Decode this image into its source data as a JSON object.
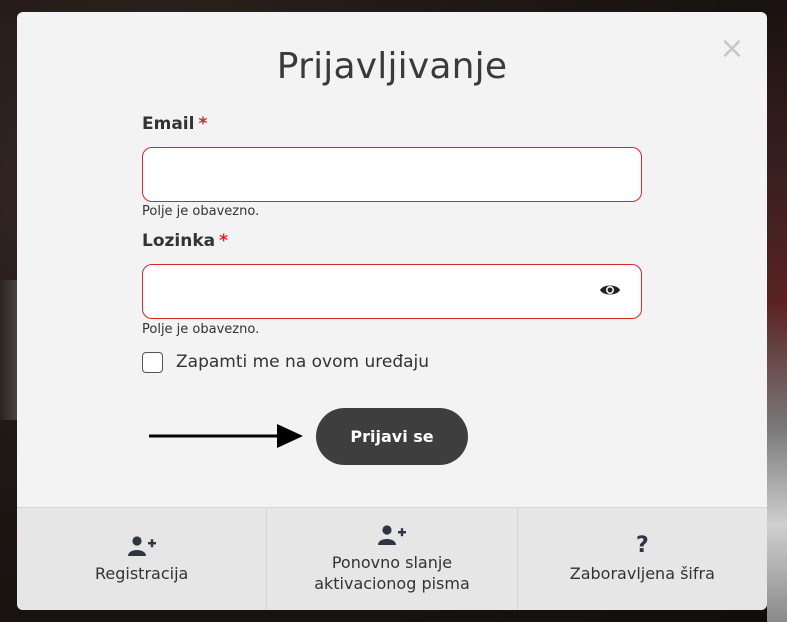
{
  "modal": {
    "title": "Prijavljivanje",
    "close_glyph": "×"
  },
  "form": {
    "email": {
      "label": "Email",
      "required_marker": "*",
      "value": "",
      "error": "Polje je obavezno."
    },
    "password": {
      "label": "Lozinka",
      "required_marker": "*",
      "value": "",
      "error": "Polje je obavezno.",
      "toggle_icon": "eye-icon"
    },
    "remember": {
      "label": "Zapamti me na ovom uređaju",
      "checked": false
    },
    "submit_label": "Prijavi se"
  },
  "footer": {
    "items": [
      {
        "label": "Registracija",
        "icon": "user-plus-icon"
      },
      {
        "label_line1": "Ponovno slanje",
        "label_line2": "aktivacionog pisma",
        "icon": "user-plus-icon"
      },
      {
        "label": "Zaboravljena šifra",
        "icon": "question-icon",
        "glyph": "?"
      }
    ]
  },
  "colors": {
    "accent_error": "#d02a2f",
    "button_bg": "#3e3e3e",
    "modal_bg": "#f3f3f3",
    "footer_bg": "#e6e6e6"
  }
}
